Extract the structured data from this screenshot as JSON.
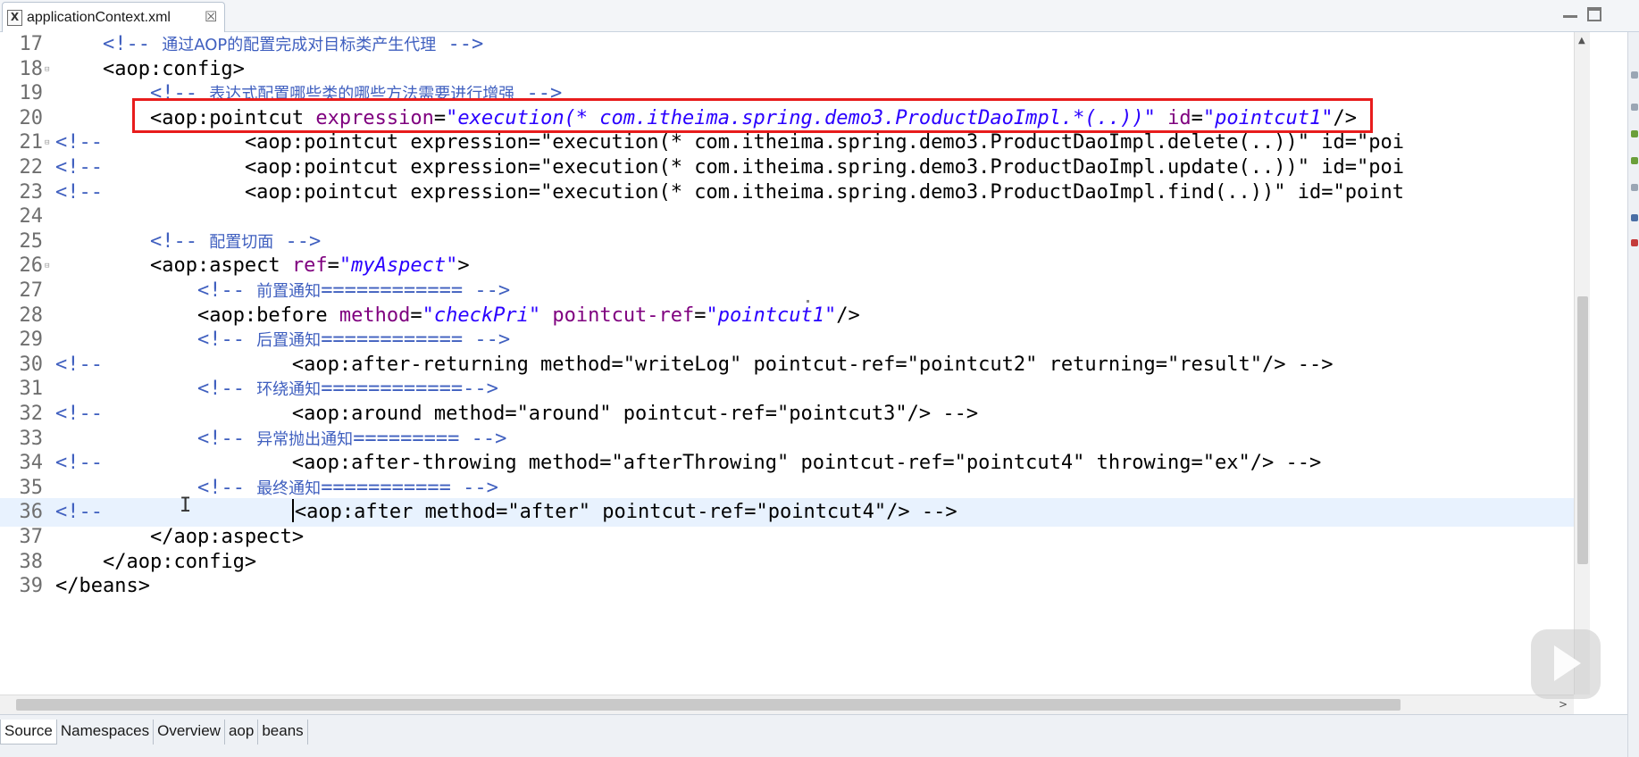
{
  "tab": {
    "title": "applicationContext.xml",
    "close_glyph": "☒",
    "icon": "xml-file-icon"
  },
  "lines": [
    {
      "n": "17",
      "active": false,
      "fold": false,
      "prefix": "",
      "code": [
        [
          "ind",
          "    "
        ],
        [
          "cmt",
          "<!-- "
        ],
        [
          "cmtcn",
          "通过AOP的配置完成对目标类产生代理"
        ],
        [
          "cmt",
          " -->"
        ]
      ]
    },
    {
      "n": "18",
      "active": false,
      "fold": true,
      "prefix": "",
      "code": [
        [
          "ind",
          "    "
        ],
        [
          "tag",
          "<aop:config>"
        ]
      ]
    },
    {
      "n": "19",
      "active": false,
      "fold": false,
      "prefix": "",
      "code": [
        [
          "ind",
          "        "
        ],
        [
          "cmt",
          "<!-- "
        ],
        [
          "cmtcn",
          "表达式配置哪些类的哪些方法需要进行增强"
        ],
        [
          "cmt",
          " -->"
        ]
      ]
    },
    {
      "n": "20",
      "active": false,
      "fold": false,
      "prefix": "",
      "code": [
        [
          "ind",
          "        "
        ],
        [
          "tag",
          "<aop:pointcut "
        ],
        [
          "attr",
          "expression"
        ],
        [
          "tag",
          "="
        ],
        [
          "val",
          "\"execution(* com.itheima.spring.demo3.ProductDaoImpl.*(..))\""
        ],
        [
          "tag",
          " "
        ],
        [
          "attr",
          "id"
        ],
        [
          "tag",
          "="
        ],
        [
          "val",
          "\"pointcut1\""
        ],
        [
          "tag",
          "/>"
        ]
      ]
    },
    {
      "n": "21",
      "active": false,
      "fold": true,
      "prefix": "<!--",
      "code": [
        [
          "ind",
          "            "
        ],
        [
          "gray",
          "<aop:pointcut expression=\"execution(* com.itheima.spring.demo3.ProductDaoImpl.delete(..))\" id=\"poi"
        ]
      ]
    },
    {
      "n": "22",
      "active": false,
      "fold": false,
      "prefix": "<!--",
      "code": [
        [
          "ind",
          "            "
        ],
        [
          "gray",
          "<aop:pointcut expression=\"execution(* com.itheima.spring.demo3.ProductDaoImpl.update(..))\" id=\"poi"
        ]
      ]
    },
    {
      "n": "23",
      "active": false,
      "fold": false,
      "prefix": "<!--",
      "code": [
        [
          "ind",
          "            "
        ],
        [
          "gray",
          "<aop:pointcut expression=\"execution(* com.itheima.spring.demo3.ProductDaoImpl.find(..))\" id=\"point"
        ]
      ]
    },
    {
      "n": "24",
      "active": false,
      "fold": false,
      "prefix": "",
      "code": []
    },
    {
      "n": "25",
      "active": false,
      "fold": false,
      "prefix": "",
      "code": [
        [
          "ind",
          "        "
        ],
        [
          "cmt",
          "<!-- "
        ],
        [
          "cmtcn",
          "配置切面"
        ],
        [
          "cmt",
          " -->"
        ]
      ]
    },
    {
      "n": "26",
      "active": false,
      "fold": true,
      "prefix": "",
      "code": [
        [
          "ind",
          "        "
        ],
        [
          "tag",
          "<aop:aspect "
        ],
        [
          "attr",
          "ref"
        ],
        [
          "tag",
          "="
        ],
        [
          "val",
          "\"myAspect\""
        ],
        [
          "tag",
          ">"
        ]
      ]
    },
    {
      "n": "27",
      "active": false,
      "fold": false,
      "prefix": "",
      "code": [
        [
          "ind",
          "            "
        ],
        [
          "cmt",
          "<!-- "
        ],
        [
          "cmtcn",
          "前置通知"
        ],
        [
          "cmt",
          "============ -->"
        ]
      ]
    },
    {
      "n": "28",
      "active": false,
      "fold": false,
      "prefix": "",
      "code": [
        [
          "ind",
          "            "
        ],
        [
          "tag",
          "<aop:before "
        ],
        [
          "attr",
          "method"
        ],
        [
          "tag",
          "="
        ],
        [
          "val",
          "\"checkPri\""
        ],
        [
          "tag",
          " "
        ],
        [
          "attr",
          "pointcut-ref"
        ],
        [
          "tag",
          "="
        ],
        [
          "val",
          "\"pointcut1\""
        ],
        [
          "tag",
          "/>"
        ]
      ]
    },
    {
      "n": "29",
      "active": false,
      "fold": false,
      "prefix": "",
      "code": [
        [
          "ind",
          "            "
        ],
        [
          "cmt",
          "<!-- "
        ],
        [
          "cmtcn",
          "后置通知"
        ],
        [
          "cmt",
          "============ -->"
        ]
      ]
    },
    {
      "n": "30",
      "active": false,
      "fold": false,
      "prefix": "<!--",
      "code": [
        [
          "ind",
          "                "
        ],
        [
          "gray",
          "<aop:after-returning method=\"writeLog\" pointcut-ref=\"pointcut2\" returning=\"result\"/> -->"
        ]
      ]
    },
    {
      "n": "31",
      "active": false,
      "fold": false,
      "prefix": "",
      "code": [
        [
          "ind",
          "            "
        ],
        [
          "cmt",
          "<!-- "
        ],
        [
          "cmtcn",
          "环绕通知"
        ],
        [
          "cmt",
          "============-->"
        ]
      ]
    },
    {
      "n": "32",
      "active": false,
      "fold": false,
      "prefix": "<!--",
      "code": [
        [
          "ind",
          "                "
        ],
        [
          "gray",
          "<aop:around method=\"around\" pointcut-ref=\"pointcut3\"/> -->"
        ]
      ]
    },
    {
      "n": "33",
      "active": false,
      "fold": false,
      "prefix": "",
      "code": [
        [
          "ind",
          "            "
        ],
        [
          "cmt",
          "<!-- "
        ],
        [
          "cmtcn",
          "异常抛出通知"
        ],
        [
          "cmt",
          "========= -->"
        ]
      ]
    },
    {
      "n": "34",
      "active": false,
      "fold": false,
      "prefix": "<!--",
      "code": [
        [
          "ind",
          "                "
        ],
        [
          "gray",
          "<aop:after-throwing method=\"afterThrowing\" pointcut-ref=\"pointcut4\" throwing=\"ex\"/> -->"
        ]
      ]
    },
    {
      "n": "35",
      "active": false,
      "fold": false,
      "prefix": "",
      "code": [
        [
          "ind",
          "            "
        ],
        [
          "cmt",
          "<!-- "
        ],
        [
          "cmtcn",
          "最终通知"
        ],
        [
          "cmt",
          "=========== -->"
        ]
      ]
    },
    {
      "n": "36",
      "active": true,
      "fold": false,
      "prefix": "<!--",
      "code": [
        [
          "ind",
          "                "
        ],
        [
          "caret",
          ""
        ],
        [
          "gray",
          "<aop:after method=\"after\" pointcut-ref=\"pointcut4\"/> -->"
        ]
      ]
    },
    {
      "n": "37",
      "active": false,
      "fold": false,
      "prefix": "",
      "code": [
        [
          "ind",
          "        "
        ],
        [
          "tag",
          "</aop:aspect>"
        ]
      ]
    },
    {
      "n": "38",
      "active": false,
      "fold": false,
      "prefix": "",
      "code": [
        [
          "ind",
          "    "
        ],
        [
          "tag",
          "</aop:config>"
        ]
      ]
    },
    {
      "n": "39",
      "active": false,
      "fold": false,
      "prefix": "",
      "code": [
        [
          "tag",
          "</beans>"
        ]
      ]
    }
  ],
  "bottom_tabs": [
    "Source",
    "Namespaces",
    "Overview",
    "aop",
    "beans"
  ],
  "active_bottom_tab": "Source",
  "colors": {
    "highlight_box": "#e81c1c",
    "attribute": "#7f007f",
    "value": "#2a00ff",
    "comment": "#3f5fbf",
    "active_line": "#e8f2fe"
  }
}
